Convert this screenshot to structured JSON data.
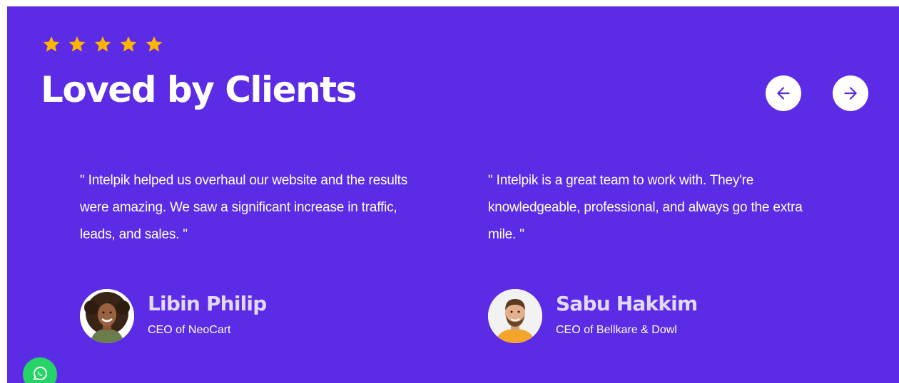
{
  "section": {
    "rating_stars": 5,
    "title": "Loved by Clients",
    "nav": {
      "prev_icon": "arrow-left-icon",
      "next_icon": "arrow-right-icon"
    }
  },
  "testimonials": [
    {
      "quote": "\" Intelpik helped us overhaul our website and the results were amazing. We saw a significant increase in traffic, leads, and sales. \"",
      "name": "Libin Philip",
      "role": "CEO of NeoCart"
    },
    {
      "quote": "\" Intelpik is a great team to work with. They're knowledgeable, professional, and always go the extra mile. \"",
      "name": "Sabu Hakkim",
      "role": "CEO of Bellkare & Dowl"
    }
  ],
  "floating": {
    "icon": "whatsapp-icon"
  },
  "colors": {
    "background": "#5b2be6",
    "star": "#ffb400",
    "name": "#e3d8ff",
    "whatsapp": "#25d366"
  }
}
